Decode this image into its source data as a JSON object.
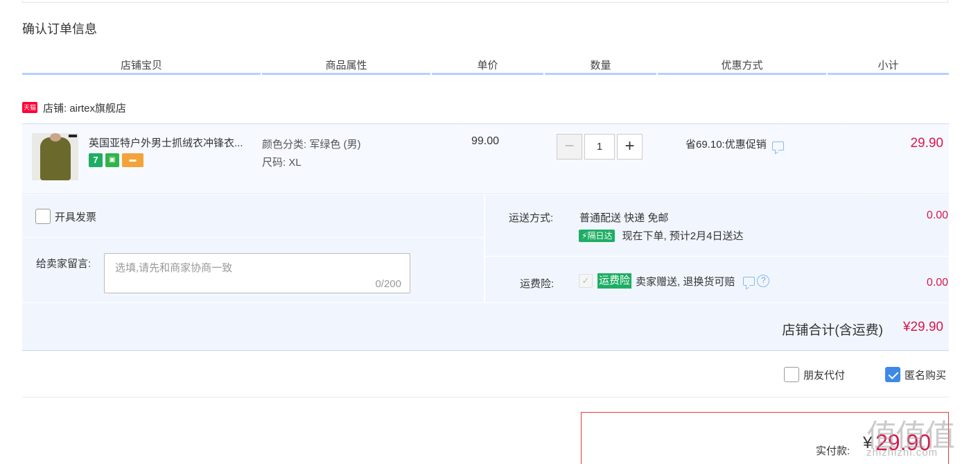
{
  "page_title": "确认订单信息",
  "columns": [
    "店铺宝贝",
    "商品属性",
    "单价",
    "数量",
    "优惠方式",
    "小计"
  ],
  "shop": {
    "badge": "天猫",
    "label": "店铺: airtex旗舰店"
  },
  "item": {
    "title": "英国亚特户外男士抓绒衣冲锋衣...",
    "icons": [
      "7",
      "bag-icon",
      "card-icon"
    ],
    "attr_color": "颜色分类: 军绿色 (男)",
    "attr_size": "尺码: XL",
    "price": "99.00",
    "qty": "1",
    "minus": "−",
    "plus": "+",
    "discount": "省69.10:优惠促销",
    "subtotal": "29.90"
  },
  "invoice_label": "开具发票",
  "message": {
    "label": "给卖家留言:",
    "placeholder": "选填,请先和商家协商一致",
    "counter": "0/200"
  },
  "shipping": {
    "label": "运送方式:",
    "value": "普通配送 快递 免邮",
    "nextday_badge": "隔日达",
    "nextday_text": "现在下单, 预计2月4日送达",
    "fee": "0.00"
  },
  "insurance": {
    "label": "运费险:",
    "badge": "运费险",
    "text": "卖家赠送, 退换货可赔",
    "help": "?",
    "fee": "0.00"
  },
  "shop_total": {
    "label": "店铺合计(含运费)",
    "amount": "¥29.90"
  },
  "options": {
    "friend_pay": "朋友代付",
    "anonymous": "匿名购买"
  },
  "payment": {
    "label": "实付款:",
    "currency": "¥",
    "amount": "29.90"
  },
  "watermark": {
    "site": "zhizhizhi.com"
  },
  "colors": {
    "accent_red": "#d8174a",
    "header_line": "#b2d1ff",
    "row_bg": "#f1f6fe",
    "green_badge": "#1dae63",
    "check_blue": "#3d89e8"
  }
}
